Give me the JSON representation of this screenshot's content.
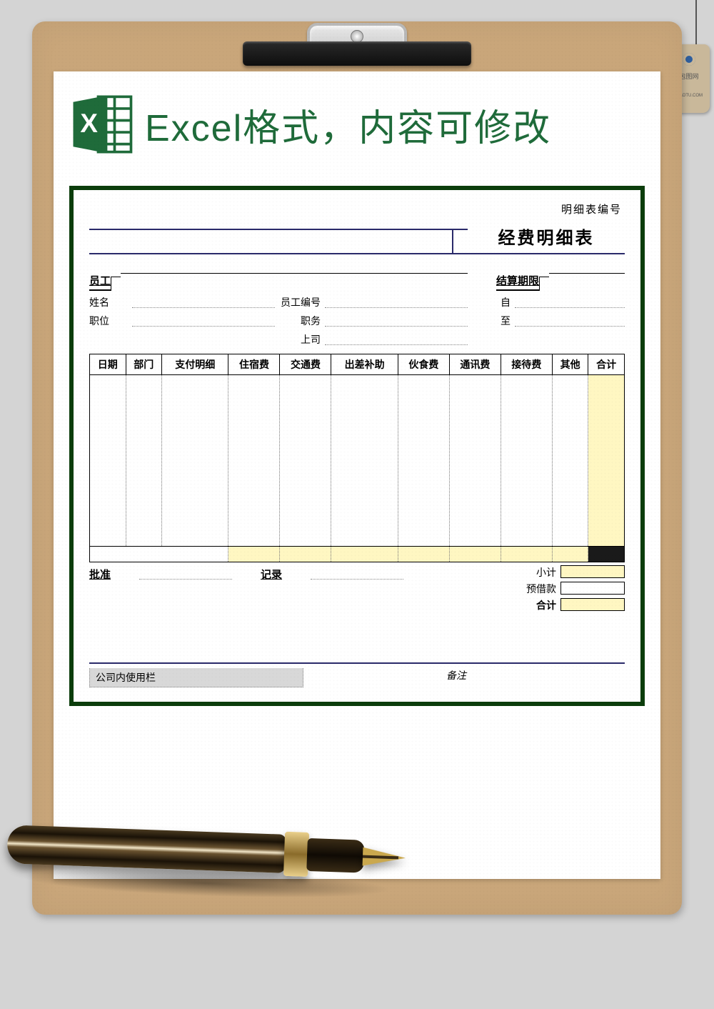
{
  "header": {
    "title": "Excel格式，内容可修改"
  },
  "tag": {
    "text1": "包图网",
    "text2": "IBAOTU.COM"
  },
  "form": {
    "sheet_no_label": "明细表编号",
    "title": "经费明细表",
    "employee_section": "员工",
    "period_section": "结算期限",
    "fields": {
      "name": "姓名",
      "emp_no": "员工编号",
      "position": "职位",
      "duty": "职务",
      "superior": "上司",
      "from": "自",
      "to": "至"
    },
    "columns": [
      "日期",
      "部门",
      "支付明细",
      "住宿费",
      "交通费",
      "出差补助",
      "伙食费",
      "通讯费",
      "接待费",
      "其他",
      "合计"
    ],
    "subtotal": "小计",
    "advance": "预借款",
    "total": "合计",
    "approve": "批准",
    "record": "记录",
    "usage": "公司内使用栏",
    "remark": "备注"
  }
}
